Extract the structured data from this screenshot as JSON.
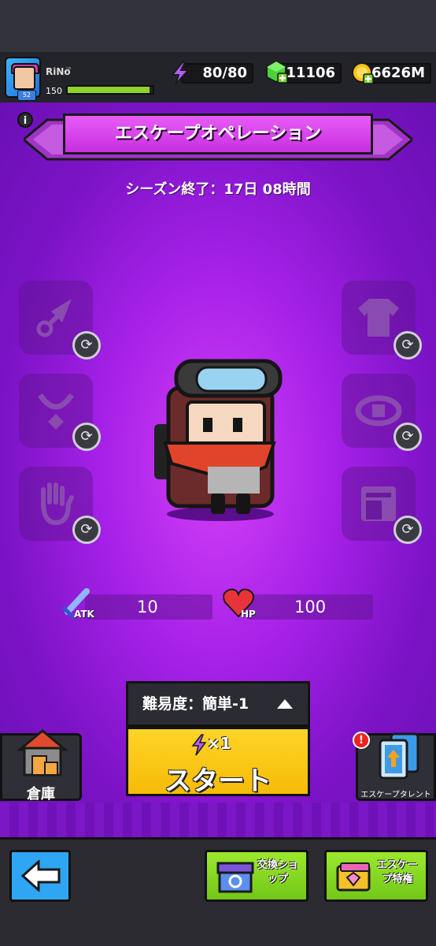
{
  "header": {
    "player_name": "RiNo",
    "player_region": "JP",
    "player_level": "150",
    "avatar_level": "52",
    "xp_fraction": 0.96,
    "energy": "80/80",
    "gems": "11106",
    "coins": "6626M"
  },
  "event": {
    "title": "エスケープオペレーション",
    "season_remaining": "シーズン終了：17日 08時間"
  },
  "equipment_slots": {
    "left": [
      "weapon-slot",
      "necklace-slot",
      "glove-slot"
    ],
    "right": [
      "armor-slot",
      "belt-slot",
      "book-slot"
    ]
  },
  "stats": {
    "atk_label": "ATK",
    "atk_value": "10",
    "hp_label": "HP",
    "hp_value": "100"
  },
  "controls": {
    "difficulty": "難易度：簡単-1",
    "start_cost": "×1",
    "start_label": "スタート",
    "warehouse_label": "倉庫",
    "talent_label": "エスケープタレント",
    "alert": "!"
  },
  "bottom_nav": {
    "exchange_shop": "交換ショップ",
    "escape_privilege": "エスケープ特権"
  },
  "colors": {
    "purple_bg": "#a621e8",
    "title_magenta": "#d447ec",
    "start_yellow": "#f9c514",
    "nav_green": "#86d824",
    "back_blue": "#2fa6f3"
  }
}
